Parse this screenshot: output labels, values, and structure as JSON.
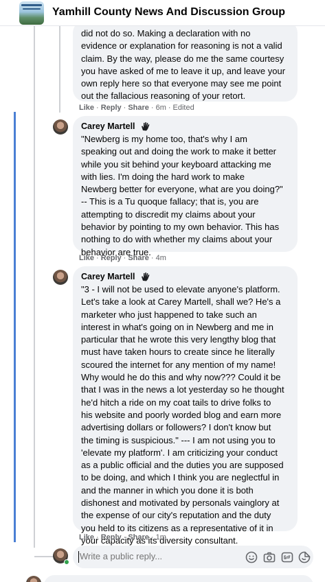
{
  "header": {
    "group_name": "Yamhill County News And Discussion Group"
  },
  "comments": [
    {
      "body": "did not do so. Making a declaration with no\nevidence or explanation for reasoning is not a valid\nclaim. By the way, please do me the same courtesy\nyou have asked of me to leave it up, and leave your\nown reply here so that everyone may see me point\nout the fallacious reasoning of your retort.",
      "like": "Like",
      "reply": "Reply",
      "share": "Share",
      "time": "6m",
      "edited": "Edited"
    },
    {
      "author": "Carey Martell",
      "body": "\"Newberg is my home too, that's why I am\nspeaking out and doing the work to make it better\nwhile you sit behind your keyboard attacking me\nwith lies. I'm doing the hard work to make\nNewberg better for everyone, what are you doing?\"\n-- This is a Tu quoque fallacy; that is, you are\nattempting to discredit my claims about your\nbehavior by pointing to my own behavior. This has\nnothing to do with whether my claims about your\nbehavior are true.",
      "like": "Like",
      "reply": "Reply",
      "share": "Share",
      "time": "4m"
    },
    {
      "author": "Carey Martell",
      "body": "\"3 - I will not be used to elevate anyone's platform.\nLet's take a look at Carey Martell, shall we? He's a\nmarketer who just happened to take such an\ninterest in what's going on in Newberg and me in\nparticular that he wrote this very lengthy blog that\nmust have taken hours to create since he literally\nscoured the internet for any mention of my name!\nWhy would he do this and why now??? Could it be\nthat I was in the news a lot yesterday so he thought\nhe'd hitch a ride on my coat tails to drive folks to\nhis website and poorly worded blog and earn more\nadvertising dollars or followers? I don't know but\nthe timing is suspicious.\" --- I am not using you to\n'elevate my platform'. I am criticizing your conduct\nas a public official and the duties you are supposed\nto be doing, and which I think you are neglectful in\nand the manner in which you done it is both\ndishonest and motivated by personals vainglory at\nthe expense of our city's reputation and the duty\nyou held to its citizens as a representative of it in\nyour capacity as its diversity consultant.",
      "like": "Like",
      "reply": "Reply",
      "share": "Share",
      "time": "1m"
    }
  ],
  "reply_box": {
    "placeholder": "Write a public reply..."
  },
  "icons": {
    "badge": "top-contributor-hand-badge-icon",
    "tools": [
      "emoji-icon",
      "camera-icon",
      "gif-icon",
      "sticker-icon"
    ]
  },
  "colors": {
    "bubble": "#f0f2f5",
    "accent_edge": "#4a7fd4",
    "online": "#31a24c",
    "meta_text": "#65676b"
  }
}
